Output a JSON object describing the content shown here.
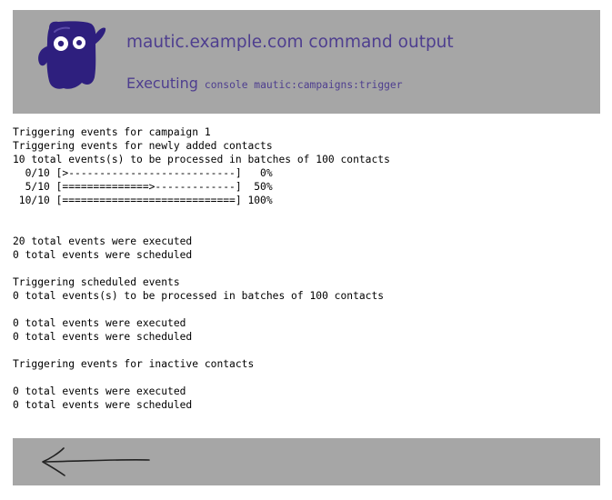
{
  "header": {
    "title": "mautic.example.com command output",
    "executing_label": "Executing",
    "command": "console mautic:campaigns:trigger"
  },
  "output": {
    "lines": [
      "Triggering events for campaign 1",
      "Triggering events for newly added contacts",
      "10 total events(s) to be processed in batches of 100 contacts",
      "  0/10 [>---------------------------]   0%",
      "  5/10 [==============>-------------]  50%",
      " 10/10 [============================] 100%",
      "",
      "",
      "20 total events were executed",
      "0 total events were scheduled",
      "",
      "Triggering scheduled events",
      "0 total events(s) to be processed in batches of 100 contacts",
      "",
      "0 total events were executed",
      "0 total events were scheduled",
      "",
      "Triggering events for inactive contacts",
      "",
      "0 total events were executed",
      "0 total events were scheduled"
    ]
  },
  "colors": {
    "header_bg": "#a6a6a6",
    "title_text": "#4e3e8f",
    "mascot_body": "#2e1f7e"
  },
  "icons": {
    "mascot": "mautic-mascot-logo",
    "back": "back-arrow-icon"
  }
}
